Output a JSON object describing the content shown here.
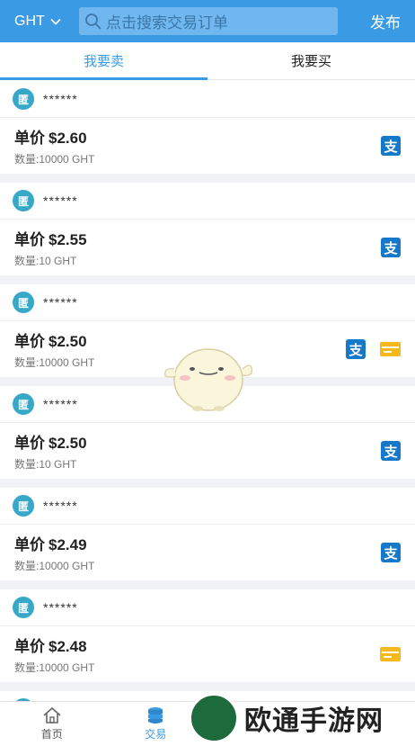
{
  "header": {
    "token": "GHT",
    "search_placeholder": "点击搜索交易订单",
    "publish_label": "发布"
  },
  "tabs": [
    {
      "label": "我要卖",
      "active": true
    },
    {
      "label": "我要买",
      "active": false
    }
  ],
  "list": {
    "price_label": "单价",
    "qty_label": "数量:",
    "anon_avatar_char": "匿",
    "items": [
      {
        "seller": "******",
        "price": "$2.60",
        "qty": "10000 GHT",
        "alipay": true,
        "bankcard": false
      },
      {
        "seller": "******",
        "price": "$2.55",
        "qty": "10 GHT",
        "alipay": true,
        "bankcard": false
      },
      {
        "seller": "******",
        "price": "$2.50",
        "qty": "10000 GHT",
        "alipay": true,
        "bankcard": true
      },
      {
        "seller": "******",
        "price": "$2.50",
        "qty": "10 GHT",
        "alipay": true,
        "bankcard": false
      },
      {
        "seller": "******",
        "price": "$2.49",
        "qty": "10000 GHT",
        "alipay": true,
        "bankcard": false
      },
      {
        "seller": "******",
        "price": "$2.48",
        "qty": "10000 GHT",
        "alipay": false,
        "bankcard": true
      },
      {
        "seller": "······",
        "price": "",
        "qty": "",
        "alipay": false,
        "bankcard": false
      }
    ]
  },
  "alipay_glyph": "支",
  "bottom_nav": [
    {
      "label": "首页",
      "icon": "home-icon",
      "active": false
    },
    {
      "label": "交易",
      "icon": "coins-icon",
      "active": true
    }
  ],
  "watermark": {
    "text": "欧通手游网"
  },
  "colors": {
    "header_bg": "#3a9be4",
    "accent": "#3a9be4",
    "avatar": "#38a8c9",
    "alipay": "#1678c9",
    "bankcard": "#f5b91e"
  }
}
